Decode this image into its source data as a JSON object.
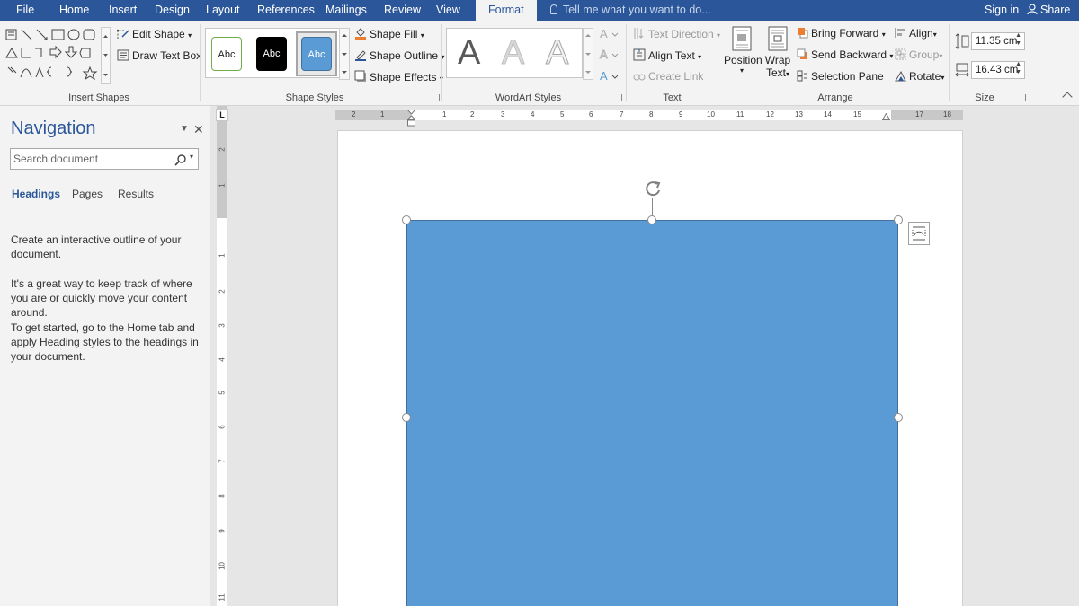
{
  "tabs": [
    {
      "label": "File",
      "active": false
    },
    {
      "label": "Home",
      "active": false
    },
    {
      "label": "Insert",
      "active": false
    },
    {
      "label": "Design",
      "active": false
    },
    {
      "label": "Layout",
      "active": false
    },
    {
      "label": "References",
      "active": false
    },
    {
      "label": "Mailings",
      "active": false
    },
    {
      "label": "Review",
      "active": false
    },
    {
      "label": "View",
      "active": false
    },
    {
      "label": "Format",
      "active": true
    }
  ],
  "tell_me": "Tell me what you want to do...",
  "sign_in": "Sign in",
  "share": "Share",
  "ribbon": {
    "insert_shapes": {
      "label": "Insert Shapes",
      "edit_shape": "Edit Shape",
      "draw_text_box": "Draw Text Box"
    },
    "shape_styles": {
      "label": "Shape Styles",
      "swatches": [
        {
          "text": "Abc",
          "bg": "#ffffff",
          "fg": "#222222",
          "border": "#70ad47"
        },
        {
          "text": "Abc",
          "bg": "#000000",
          "fg": "#ffffff",
          "border": "#000000"
        },
        {
          "text": "Abc",
          "bg": "#5b9bd5",
          "fg": "#ffffff",
          "border": "#41719c"
        }
      ],
      "shape_fill": "Shape Fill",
      "shape_outline": "Shape Outline",
      "shape_effects": "Shape Effects"
    },
    "wordart_styles": {
      "label": "WordArt Styles",
      "letters": [
        "A",
        "A",
        "A"
      ]
    },
    "text": {
      "label": "Text",
      "text_direction": "Text Direction",
      "align_text": "Align Text",
      "create_link": "Create Link"
    },
    "arrange": {
      "label": "Arrange",
      "position": "Position",
      "wrap_text_line1": "Wrap",
      "wrap_text_line2": "Text",
      "bring_forward": "Bring Forward",
      "send_backward": "Send Backward",
      "selection_pane": "Selection Pane",
      "align": "Align",
      "group": "Group",
      "rotate": "Rotate"
    },
    "size": {
      "label": "Size",
      "height": "11.35 cm",
      "width": "16.43 cm"
    }
  },
  "navigation": {
    "title": "Navigation",
    "search_placeholder": "Search document",
    "tabs": [
      "Headings",
      "Pages",
      "Results"
    ],
    "active_tab": "Headings",
    "help_1": "Create an interactive outline of your document.",
    "help_2": "It's a great way to keep track of where you are or quickly move your content around.",
    "help_3": "To get started, go to the Home tab and apply Heading styles to the headings in your document."
  },
  "ruler": {
    "horizontal_labels": [
      "2",
      "1",
      "1",
      "2",
      "3",
      "4",
      "5",
      "6",
      "7",
      "8",
      "9",
      "10",
      "11",
      "12",
      "13",
      "14",
      "15",
      "17",
      "18"
    ],
    "vertical_labels": [
      "2",
      "1",
      "1",
      "2",
      "3",
      "4",
      "5",
      "6",
      "7",
      "8",
      "9",
      "10",
      "11"
    ],
    "tab_selector": "L"
  },
  "colors": {
    "ribbon_blue": "#2b579a",
    "shape_fill": "#5b9bd5",
    "shape_outline": "#41719c"
  }
}
